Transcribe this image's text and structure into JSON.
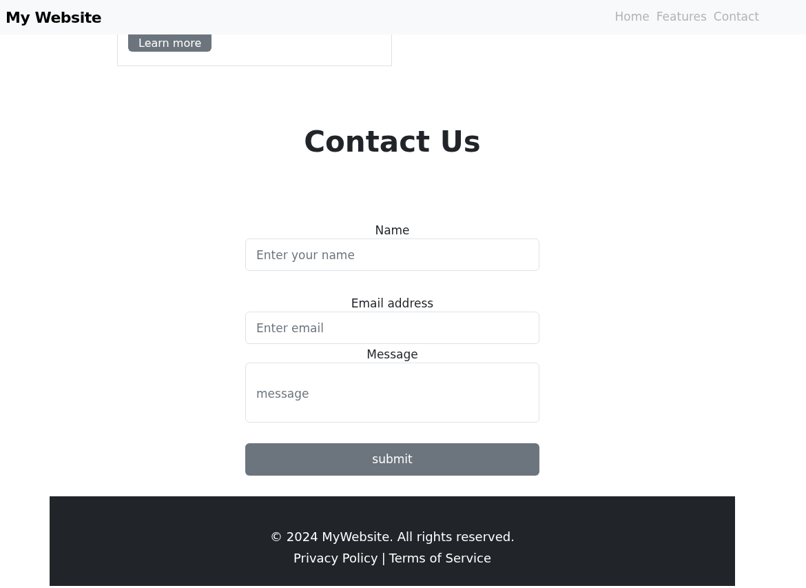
{
  "navbar": {
    "brand": "My Website",
    "links": [
      {
        "label": "Home"
      },
      {
        "label": "Features"
      },
      {
        "label": "Contact"
      }
    ]
  },
  "card": {
    "button": "Learn more"
  },
  "contact": {
    "title": "Contact Us",
    "fields": [
      {
        "kind": "input",
        "label": "Name",
        "placeholder": "Enter your name"
      },
      {
        "kind": "input",
        "label": "Email address",
        "placeholder": "Enter email"
      },
      {
        "kind": "textarea",
        "label": "Message",
        "placeholder": "message"
      }
    ],
    "submit": "submit"
  },
  "footer": {
    "copyright": "© 2024 MyWebsite. All rights reserved.",
    "links": [
      "Privacy Policy",
      "Terms of Service"
    ],
    "separator": "|"
  }
}
